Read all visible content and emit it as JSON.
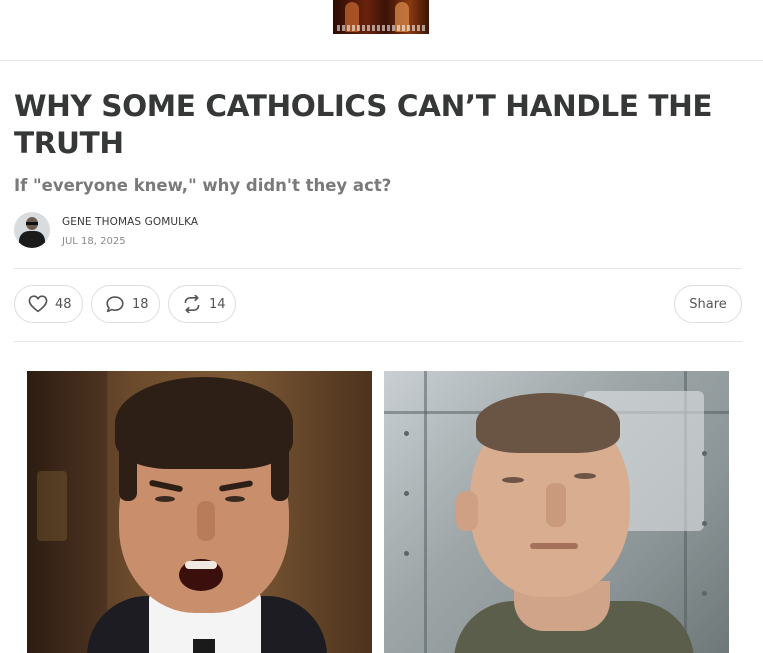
{
  "header": {
    "logo_icon": "publication-logo-image"
  },
  "article": {
    "title": "WHY SOME CATHOLICS CAN’T HANDLE THE TRUTH",
    "subtitle": "If \"everyone knew,\" why didn't they act?",
    "author": "GENE THOMAS GOMULKA",
    "date": "JUL 18, 2025"
  },
  "actions": {
    "likes": "48",
    "comments": "18",
    "restacks": "14",
    "share_label": "Share",
    "like_icon": "heart-icon",
    "comment_icon": "comment-bubble-icon",
    "restack_icon": "restack-icon"
  },
  "images": [
    {
      "icon": "man-shouting-photo"
    },
    {
      "icon": "man-in-flight-suit-photo"
    }
  ]
}
